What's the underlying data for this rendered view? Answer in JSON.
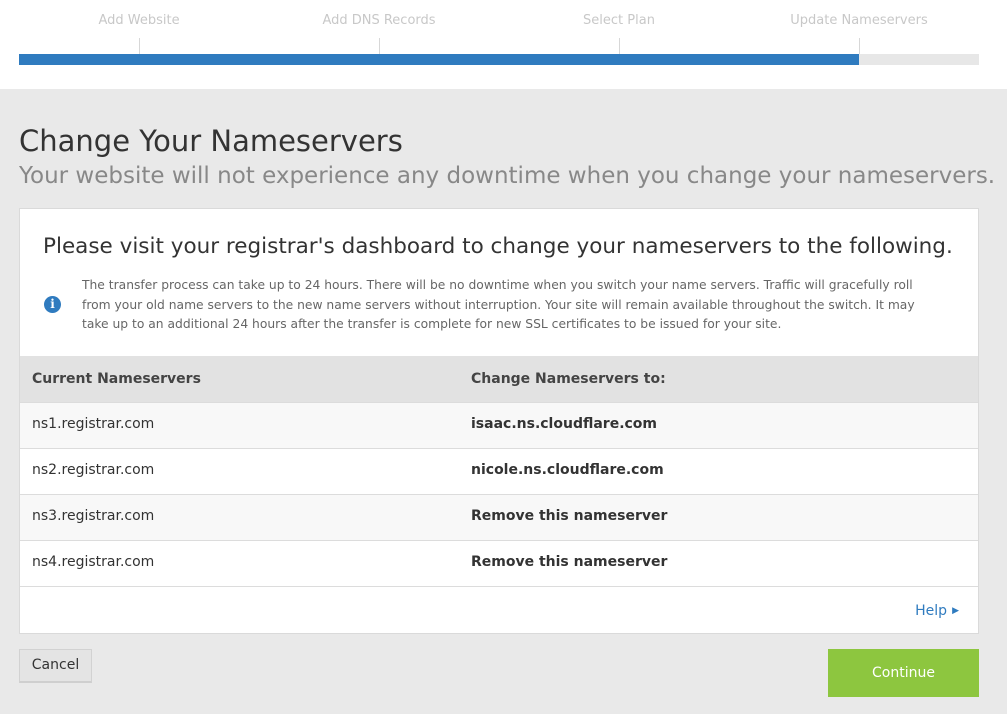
{
  "progress": {
    "steps": [
      "Add Website",
      "Add DNS Records",
      "Select Plan",
      "Update Nameservers"
    ],
    "current_step_index": 3,
    "fill_fraction": 0.875,
    "fill_color": "#2f7bbf"
  },
  "header": {
    "title": "Change Your Nameservers",
    "subtitle": "Your website will not experience any downtime when you change your nameservers."
  },
  "card": {
    "heading": "Please visit your registrar's dashboard to change your nameservers to the following.",
    "info_icon": "info-circle-icon",
    "info_text": "The transfer process can take up to 24 hours. There will be no downtime when you switch your name servers. Traffic will gracefully roll from your old name servers to the new name servers without interruption. Your site will remain available throughout the switch. It may take up to an additional 24 hours after the transfer is complete for new SSL certificates to be issued for your site."
  },
  "table": {
    "headers": [
      "Current Nameservers",
      "Change Nameservers to:"
    ],
    "rows": [
      {
        "current": "ns1.registrar.com",
        "change_to": "isaac.ns.cloudflare.com"
      },
      {
        "current": "ns2.registrar.com",
        "change_to": "nicole.ns.cloudflare.com"
      },
      {
        "current": "ns3.registrar.com",
        "change_to": "Remove this nameserver"
      },
      {
        "current": "ns4.registrar.com",
        "change_to": "Remove this nameserver"
      }
    ]
  },
  "help": {
    "label": "Help",
    "icon": "caret-right-icon"
  },
  "actions": {
    "cancel_label": "Cancel",
    "continue_label": "Continue",
    "continue_color": "#8dc63f"
  }
}
